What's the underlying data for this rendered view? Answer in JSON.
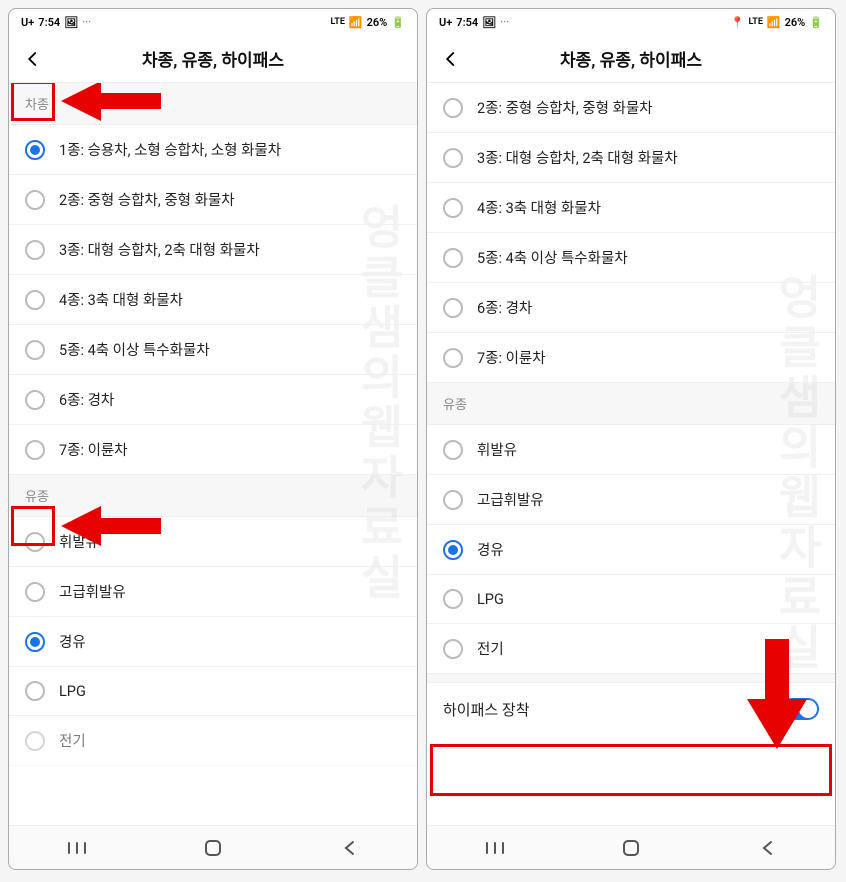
{
  "status": {
    "carrier": "U+",
    "time": "7:54",
    "network": "LTE",
    "battery": "26%"
  },
  "header": {
    "title": "차종, 유종, 하이패스"
  },
  "sections": {
    "vehicle_type": "차종",
    "fuel_type": "유종"
  },
  "vehicle_options": [
    {
      "label": "1종: 승용차, 소형 승합차, 소형 화물차"
    },
    {
      "label": "2종: 중형 승합차, 중형 화물차"
    },
    {
      "label": "3종: 대형 승합차, 2축 대형 화물차"
    },
    {
      "label": "4종: 3축 대형 화물차"
    },
    {
      "label": "5종: 4축 이상 특수화물차"
    },
    {
      "label": "6종: 경차"
    },
    {
      "label": "7종: 이륜차"
    }
  ],
  "fuel_options": [
    {
      "label": "휘발유"
    },
    {
      "label": "고급휘발유"
    },
    {
      "label": "경유"
    },
    {
      "label": "LPG"
    },
    {
      "label": "전기"
    }
  ],
  "left_selected_vehicle": 0,
  "left_selected_fuel": 2,
  "right_selected_fuel": 2,
  "hipass": {
    "label": "하이패스 장착",
    "on": true
  },
  "watermark": "엉클샘의웹자료실"
}
